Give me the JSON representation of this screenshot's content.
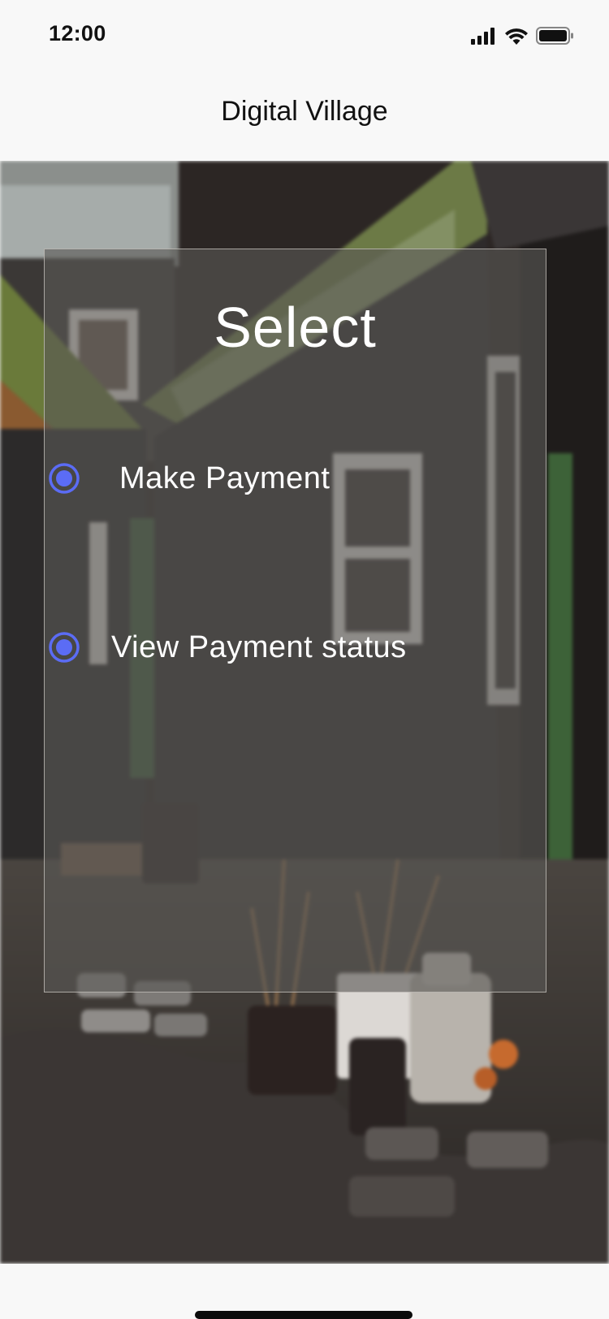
{
  "status_bar": {
    "time": "12:00",
    "icons": [
      "signal-icon",
      "wifi-icon",
      "battery-icon"
    ]
  },
  "header": {
    "title": "Digital Village"
  },
  "card": {
    "title": "Select",
    "options": [
      {
        "label": "Make Payment"
      },
      {
        "label": "View Payment status"
      }
    ]
  },
  "colors": {
    "accent": "#5b6cf5",
    "card_overlay": "#5a5856",
    "bar_background": "#f8f8f8"
  }
}
